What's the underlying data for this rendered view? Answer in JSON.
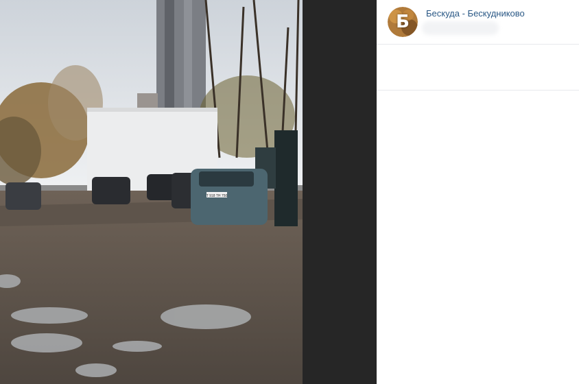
{
  "photo": {
    "plate_text": "Т 918 ТН 750"
  },
  "post": {
    "author": "Бескуда - Бескудниково",
    "avatar_letter": "Б"
  },
  "colors": {
    "link": "#2a5885",
    "divider": "#e7e8ec",
    "viewer_bg": "#262626"
  }
}
